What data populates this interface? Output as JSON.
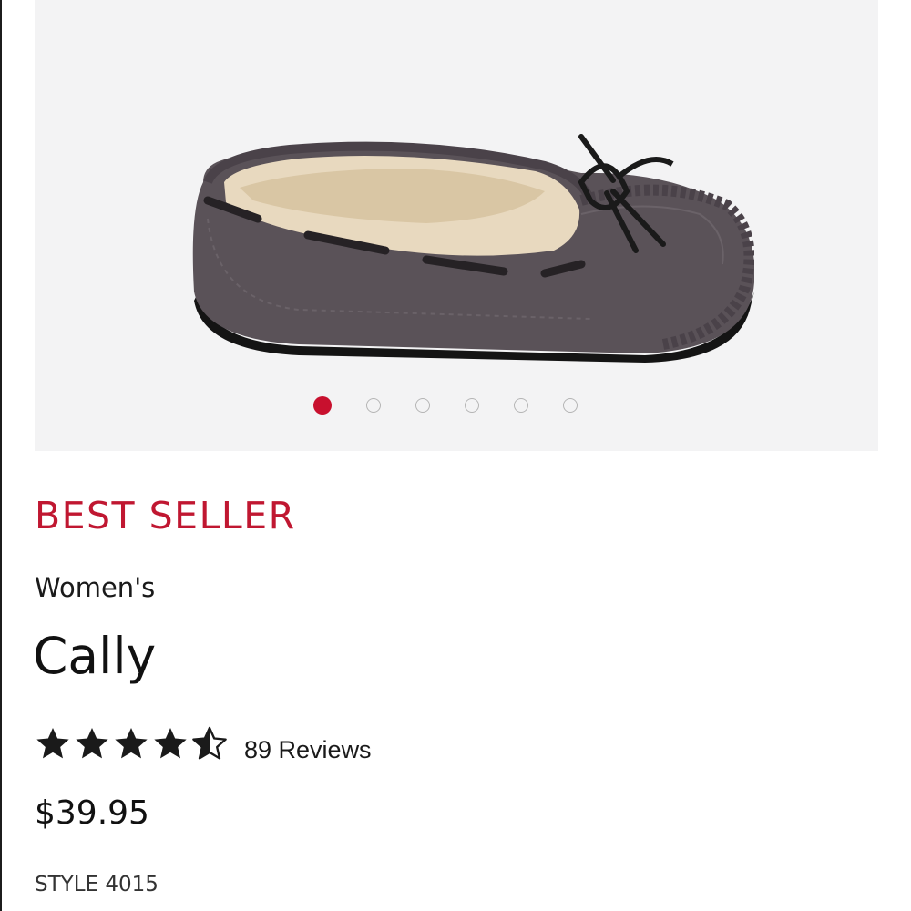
{
  "gallery": {
    "image_alt": "product-image-moccasin",
    "slide_count": 6,
    "active_slide": 1,
    "active_dot_color": "#c8102e"
  },
  "product": {
    "badge": "BEST SELLER",
    "badge_color": "#c01731",
    "category": "Women's",
    "name": "Cally",
    "rating": 4.5,
    "rating_max": 5,
    "reviews_label": "89 Reviews",
    "price": "$39.95",
    "style": "STYLE 4015"
  }
}
